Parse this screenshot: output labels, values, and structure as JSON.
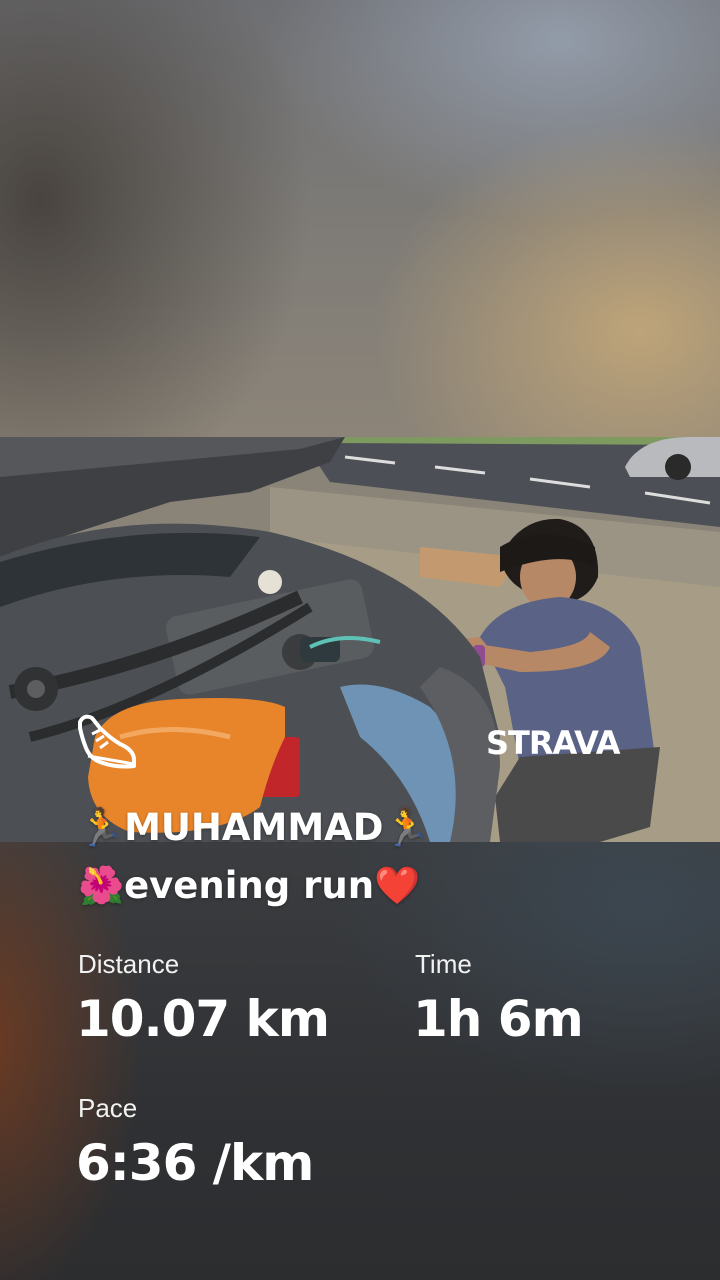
{
  "brand": {
    "name": "STRAVA",
    "activity_icon": "running-shoe-icon"
  },
  "activity": {
    "title_line1": "🏃MUHAMMAD🏃",
    "title_line2": "🌺evening run❤️"
  },
  "stats": {
    "distance": {
      "label": "Distance",
      "value": "10.07 km"
    },
    "time": {
      "label": "Time",
      "value": "1h 6m"
    },
    "pace": {
      "label": "Pace",
      "value": "6:36 /km"
    }
  },
  "colors": {
    "text": "#ffffff",
    "brand_white": "#ffffff",
    "bag_orange": "#e8852a"
  }
}
